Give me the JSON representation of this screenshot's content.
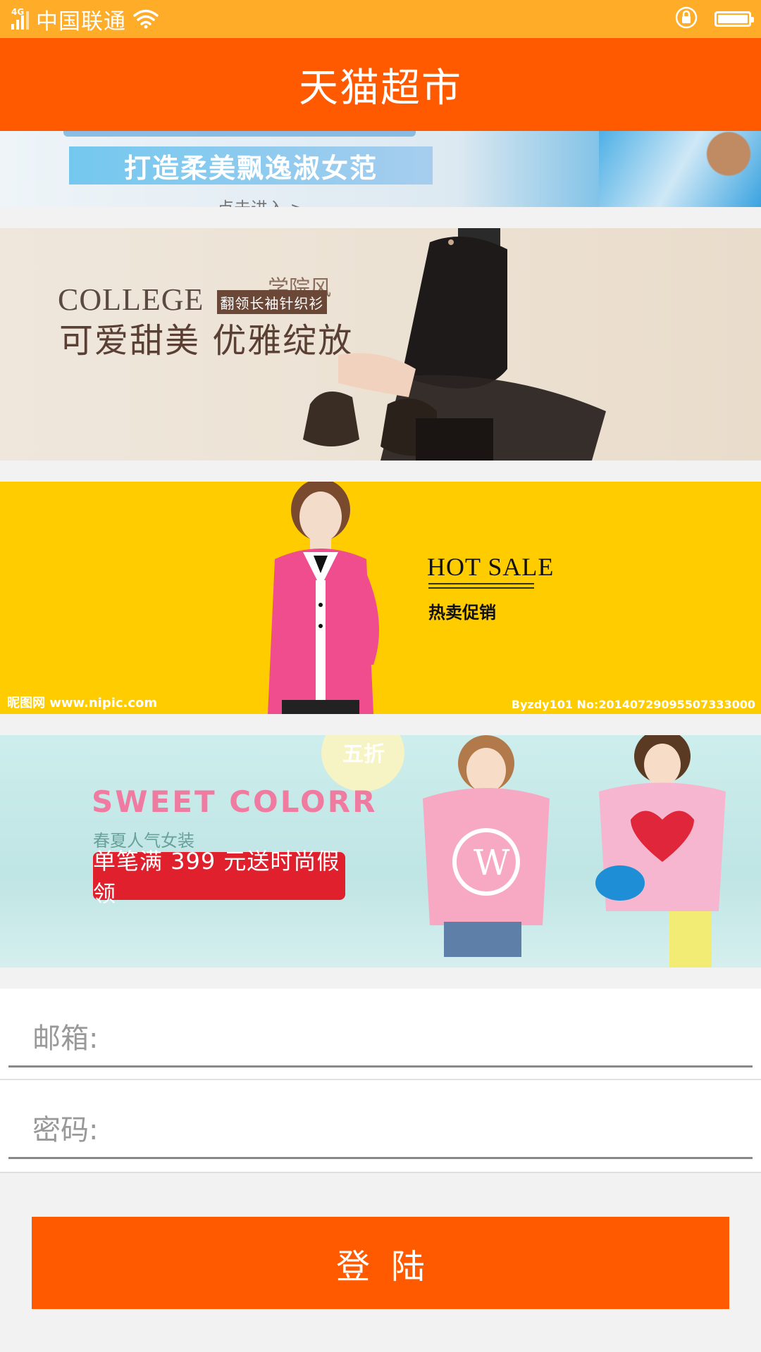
{
  "status_bar": {
    "network": "4G",
    "carrier": "中国联通"
  },
  "header": {
    "title": "天猫超市"
  },
  "banners": [
    {
      "slogan": "打造柔美飘逸淑女范",
      "link_text": "点击进入 >"
    },
    {
      "tag": "学院风",
      "title": "COLLEGE",
      "subtag": "翻领长袖针织衫",
      "slogan": "可爱甜美  优雅绽放"
    },
    {
      "title": "HOT SALE",
      "subtitle": "热卖促销",
      "watermark_left": "昵图网 www.nipic.com",
      "watermark_right": "Byzdy101 No:20140729095507333000"
    },
    {
      "badge": "五折",
      "title": "SWEET  COLORR",
      "subtitle": "春夏人气女装",
      "promo": "单笔满 399 元送时尚假领"
    }
  ],
  "form": {
    "email_label": "邮箱:",
    "password_label": "密码:",
    "email_value": "",
    "password_value": ""
  },
  "login_button": "登陆",
  "colors": {
    "status_bar": "#ffad28",
    "accent": "#ff5a00",
    "background": "#f2f2f2"
  }
}
